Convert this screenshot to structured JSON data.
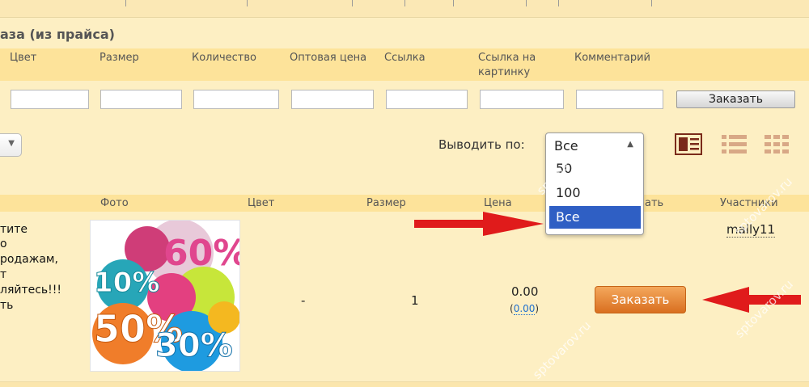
{
  "section_title": "аза (из прайса)",
  "price_form": {
    "headers": [
      "Цвет",
      "Размер",
      "Количество",
      "Оптовая цена",
      "Ссылка",
      "Ссылка на",
      "картинку",
      "Комментарий"
    ],
    "order_label": "Заказать"
  },
  "toolbar": {
    "show_label": "Выводить по:",
    "dropdown_current": "Все",
    "options": [
      "50",
      "100",
      "Все"
    ],
    "selected_option": "Все"
  },
  "table": {
    "headers": [
      "Фото",
      "Цвет",
      "Размер",
      "Цена",
      "ать",
      "Участники"
    ],
    "row": {
      "desc_lines": [
        "тите",
        "о",
        "родажам,",
        "т",
        "ляйтесь!!!",
        "ть"
      ],
      "color": "-",
      "size": "1",
      "price": "0.00",
      "price_open": "(",
      "price_sub": "0.00",
      "price_close": ")",
      "order_label": "Заказать",
      "participant": "mally11"
    }
  },
  "photo_percents": [
    "60%",
    "10%",
    "50%",
    "30%"
  ],
  "watermark": "sptovarov.ru",
  "colors": {
    "accent_orange": "#e07a2a",
    "selected_blue": "#2f5fc4",
    "arrow_red": "#e01b1b"
  }
}
